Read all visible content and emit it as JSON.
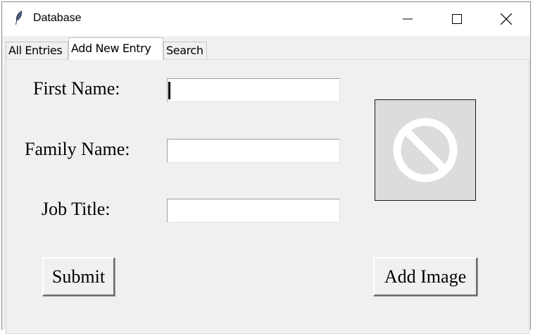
{
  "window": {
    "title": "Database",
    "controls": [
      "minimize-icon",
      "maximize-icon",
      "close-icon"
    ]
  },
  "tabs": [
    {
      "label": "All Entries",
      "active": false
    },
    {
      "label": "Add New Entry",
      "active": true
    },
    {
      "label": "Search",
      "active": false
    }
  ],
  "form": {
    "first_name_label": "First Name:",
    "first_name_value": "",
    "family_name_label": "Family Name:",
    "family_name_value": "",
    "job_title_label": "Job Title:",
    "job_title_value": ""
  },
  "image": {
    "icon": "no-image-icon",
    "background": "#dcdcdc",
    "symbol_color": "#ffffff"
  },
  "buttons": {
    "submit_label": "Submit",
    "add_image_label": "Add Image"
  }
}
